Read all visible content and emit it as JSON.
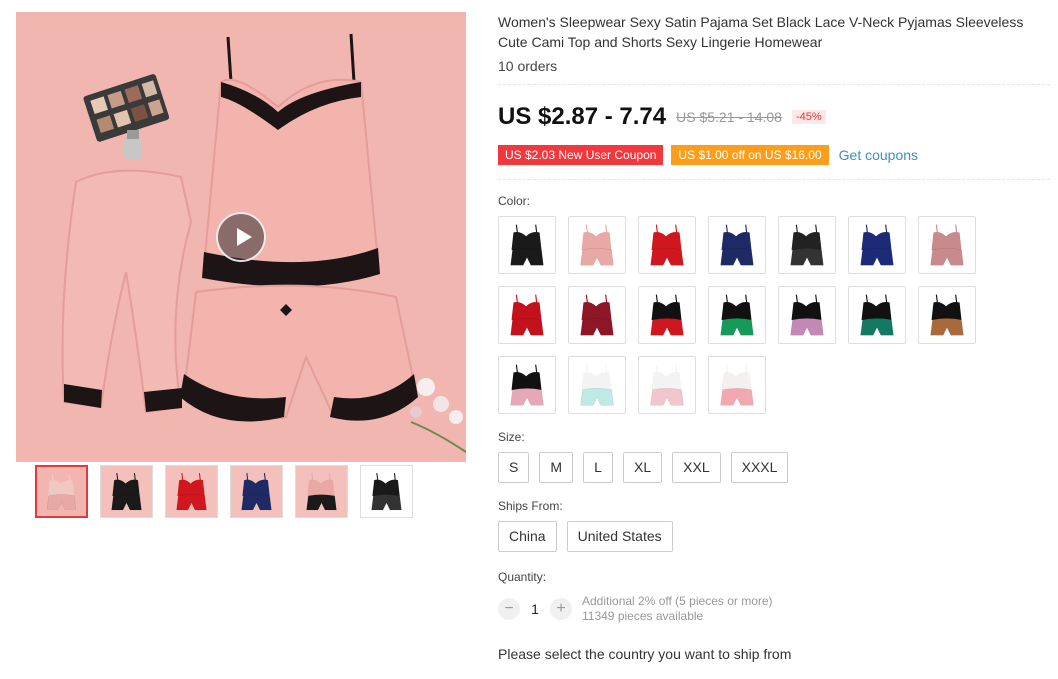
{
  "product": {
    "title": "Women's Sleepwear Sexy Satin Pajama Set Black Lace V-Neck Pyjamas Sleeveless Cute Cami Top and Shorts Sexy Lingerie Homewear",
    "orders": "10 orders",
    "price": "US $2.87 - 7.74",
    "old_price": "US $5.21 - 14.08",
    "discount": "-45%"
  },
  "coupons": {
    "new_user": "US $2.03 New User Coupon",
    "store": "US $1.00 off on US $16.00",
    "get_link": "Get coupons"
  },
  "color": {
    "label": "Color:",
    "swatches": [
      {
        "top": "#1a1a1a",
        "bottom": "#1a1a1a",
        "bg": "#ffffff"
      },
      {
        "top": "#e8a8a4",
        "bottom": "#e8a8a4",
        "bg": "#ffffff"
      },
      {
        "top": "#d0161e",
        "bottom": "#d0161e",
        "bg": "#ffffff"
      },
      {
        "top": "#1e2a66",
        "bottom": "#1e2a66",
        "bg": "#ffffff"
      },
      {
        "top": "#222222",
        "bottom": "#333333",
        "bg": "#ffffff"
      },
      {
        "top": "#1c2a78",
        "bottom": "#1c2a78",
        "bg": "#ffffff"
      },
      {
        "top": "#c98a8e",
        "bottom": "#c98a8e",
        "bg": "#ffffff"
      },
      {
        "top": "#c3121c",
        "bottom": "#c3121c",
        "bg": "#ffffff"
      },
      {
        "top": "#8e1626",
        "bottom": "#8e1626",
        "bg": "#ffffff"
      },
      {
        "top": "#111111",
        "bottom": "#d0161e",
        "bg": "#ffffff"
      },
      {
        "top": "#111111",
        "bottom": "#159a5a",
        "bg": "#ffffff"
      },
      {
        "top": "#111111",
        "bottom": "#c488b6",
        "bg": "#ffffff"
      },
      {
        "top": "#111111",
        "bottom": "#127a62",
        "bg": "#ffffff"
      },
      {
        "top": "#111111",
        "bottom": "#a86a3a",
        "bg": "#ffffff"
      },
      {
        "top": "#111111",
        "bottom": "#e6a8b6",
        "bg": "#ffffff"
      },
      {
        "top": "#f3f3f3",
        "bottom": "#bfe9e4",
        "bg": "#ffffff"
      },
      {
        "top": "#f3f3f3",
        "bottom": "#f1c6cc",
        "bg": "#ffffff"
      },
      {
        "top": "#f5f0f0",
        "bottom": "#f2a8b0",
        "bg": "#ffffff"
      }
    ]
  },
  "size": {
    "label": "Size:",
    "options": [
      "S",
      "M",
      "L",
      "XL",
      "XXL",
      "XXXL"
    ]
  },
  "ships_from": {
    "label": "Ships From:",
    "options": [
      "China",
      "United States"
    ]
  },
  "quantity": {
    "label": "Quantity:",
    "minus": "−",
    "value": "1",
    "plus": "+",
    "promo": "Additional 2% off (5 pieces or more)",
    "available": "11349 pieces available"
  },
  "shipping_note": "Please select the country you want to ship from",
  "gallery": {
    "thumbnails": [
      {
        "bg": "#f2b6b0",
        "top": "#f0c8c2",
        "bottom": "#e8a8a4"
      },
      {
        "bg": "#f4c0bc",
        "top": "#1a1a1a",
        "bottom": "#1a1a1a"
      },
      {
        "bg": "#f4c0bc",
        "top": "#d0161e",
        "bottom": "#d0161e"
      },
      {
        "bg": "#f4c0bc",
        "top": "#1e2a66",
        "bottom": "#1e2a66"
      },
      {
        "bg": "#f4c0bc",
        "top": "#e8a8a4",
        "bottom": "#1a1a1a"
      },
      {
        "bg": "#ffffff",
        "top": "#1a1a1a",
        "bottom": "#333333"
      }
    ],
    "active_index": 0
  },
  "icons": {
    "play": "play-icon"
  },
  "colors": {
    "accent_red": "#f0383d",
    "accent_orange": "#fc9e1b",
    "link_blue": "#3f8fbf",
    "main_bg": "#f2b6b0"
  }
}
